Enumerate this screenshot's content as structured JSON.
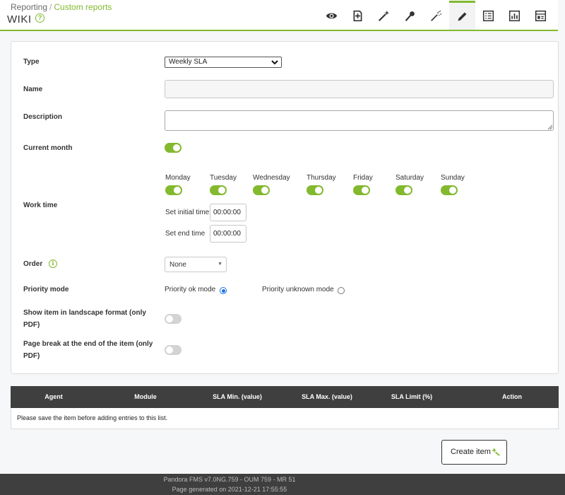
{
  "breadcrumb": {
    "parent": "Reporting",
    "separator": "/",
    "current": "Custom reports"
  },
  "page_title": "WIKI",
  "toolbar": [
    "eye-icon",
    "add-item-icon",
    "wizard-icon",
    "pin-icon",
    "sla-wizard-icon",
    "pencil-icon",
    "list-icon",
    "chart-icon",
    "dashboard-icon"
  ],
  "colors": {
    "accent": "#82b92e",
    "dark": "#3f3f3f"
  },
  "form": {
    "type_label": "Type",
    "type_value": "Weekly SLA",
    "name_label": "Name",
    "name_value": "",
    "description_label": "Description",
    "description_value": "",
    "current_month_label": "Current month",
    "current_month_on": true,
    "work_time_label": "Work time",
    "days": [
      {
        "label": "Monday",
        "on": true
      },
      {
        "label": "Tuesday",
        "on": true
      },
      {
        "label": "Wednesday",
        "on": true
      },
      {
        "label": "Thursday",
        "on": true
      },
      {
        "label": "Friday",
        "on": true
      },
      {
        "label": "Saturday",
        "on": true
      },
      {
        "label": "Sunday",
        "on": true
      }
    ],
    "initial_time_label": "Set initial time",
    "initial_time_value": "00:00:00",
    "end_time_label": "Set end time",
    "end_time_value": "00:00:00",
    "order_label": "Order",
    "order_value": "None",
    "priority_label": "Priority mode",
    "priority_ok_label": "Priority ok mode",
    "priority_unknown_label": "Priority unknown mode",
    "priority_selected": "ok",
    "landscape_label_1": "Show item in landscape format (only",
    "landscape_label_2": "PDF)",
    "landscape_on": false,
    "page_break_label_1": "Page break at the end of the item (only",
    "page_break_label_2": "PDF)",
    "page_break_on": false
  },
  "table": {
    "columns": [
      "Agent",
      "Module",
      "SLA Min. (value)",
      "SLA Max. (value)",
      "SLA Limit (%)",
      "Action"
    ],
    "empty_message": "Please save the item before adding entries to this list."
  },
  "create_button_label": "Create item",
  "footer": {
    "line1": "Pandora FMS v7.0NG.759 - OUM 759 - MR 51",
    "line2": "Page generated on 2021-12-21 17:55:55"
  }
}
